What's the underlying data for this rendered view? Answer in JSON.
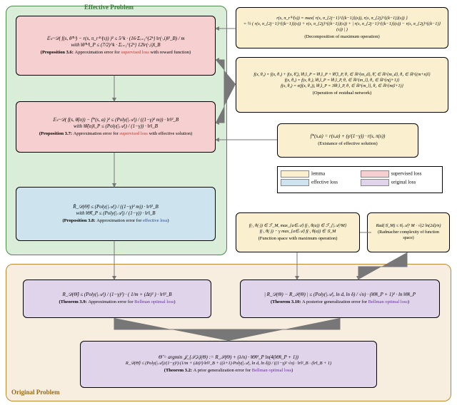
{
  "groups": {
    "effective_title": "Effective Problem",
    "original_title": "Original Problem"
  },
  "boxes": {
    "p36": {
      "math1": "𝔼ₛ~𝒟( f(s, θ̂⁽ᵏ⁾) − r(s, π_r⁽ᵏ⁾(s)) )² ≤ 5^k · (16·Σᵢ₌₁^{2ᵏ} ‖r(·,i)‖²_B) / m",
      "math2": "with  ‖θ̂⁽ᵏ⁾‖_P ≤ (7/2)^k · Σᵢ₌₁^{2ᵏ} 12‖r(·,i)‖_B",
      "caption_strong": "(Proposition 3.6: ",
      "caption_mid": "Approximation error for ",
      "caption_hl": "supervised loss",
      "caption_end": " with reward function)"
    },
    "p37": {
      "math1": "𝔼ₛ~𝒟( f(s, θ̂(α)) − f*(s, a) )² ≤ (Poly(|𝒜|) / ((1−γ)² m)) · ‖r‖²_B",
      "math2": "with  ‖θ̂(α)‖_P ≤ (Poly(|𝒜|) / (1−γ)) · ‖r‖_B",
      "caption_strong": "(Proposition 3.7: ",
      "caption_mid": "Approximation error for ",
      "caption_hl": "supervised loss",
      "caption_end": " with effective solution)"
    },
    "p38": {
      "math1": "R̂_𝒟(Θ̂) ≤ (Poly(|𝒜|) / ((1−γ)² m)) · ‖r‖²_B",
      "math2": "with  ‖Θ̂‖_P ≤ (Poly(|𝒜|) / (1−γ)) · ‖r‖_B",
      "caption_strong": "(Proposition 3.8: ",
      "caption_mid": "Approximation error for ",
      "caption_hl": "effective loss",
      "caption_end": ")"
    },
    "t39": {
      "math1": "R_𝒟(Θ̂) ≤ (Poly(|𝒜|) / (1−γ)²) · ( 1/m + (Δt)² ) · ‖r‖²_B",
      "caption_strong": "(Theorem 3.9: ",
      "caption_mid": "Approximation error for ",
      "caption_hl": "Bellman optimal loss",
      "caption_end": ")"
    },
    "t310": {
      "math1": "| R_𝒟(Θ) − R_𝒮(Θ) | ≤ (Poly(|𝒜|, ln d, ln δ) / √n) · (‖Θ‖_P + 1)² · ln ‖Θ‖_P",
      "caption_strong": "(Theorem 3.10: ",
      "caption_mid": "A posterior generalization error for ",
      "caption_hl": "Bellman optimal loss",
      "caption_end": ")"
    },
    "t32": {
      "math1": "Θ̂ = argmin 𝒥_{𝒮,λ}(Θ) := R_𝒮(Θ) + (λ/n) · ‖Θ‖²_P ln(4(‖Θ‖_P + 1))",
      "math2": "R_𝒟(Θ̂) ≤ (Poly(|𝒜|)/(1−γ)²)·(1/m + (Δt)²)·‖r‖²_B + ((λ+1)·Poly(|𝒜|, ln d, ln δ)) / ((1−γ)² √n) · ‖r‖²_B · (‖r‖_B + 1)",
      "caption_strong": "(Theorem 3.2: ",
      "caption_mid": "A prior generalization error for ",
      "caption_hl": "Bellman optimal loss",
      "caption_end": ")"
    },
    "lem_decomp": {
      "math1": "r(s, π_r⁽ᵏ⁾(s)) = max{ r(s, π_{2j−1}^{(k−1)}(s)), r(s, π_{2j}^{(k−1)}(s)) }",
      "math2": "= ½ ( r(s, π_{2j−1}^{(k−1)}(s)) + r(s, π_{2j}^{(k−1)}(s)) + | r(s, π_{2j−1}^{(k−1)}(s)) − r(s, π_{2j}^{(k−1)}(s)) | )",
      "caption": "(Decomposition of maximum operation)"
    },
    "lem_residual": {
      "math1": "f(x, θ₂) = f(x, θ₁) + f(x, θ̃₂),  ‖θ₂‖_P = ‖θ₁‖_P + ‖θ̃₂‖_P,  θ₁ ∈ ℝ^{m_d}, θ̃₂ ∈ ℝ^{m_d}, θ₂ ∈ ℝ^{(m+n)l}",
      "math2": "f(x, θ₂) = f(x, θ₁),  ‖θ₂‖_P = ‖θ₁‖_P,  θ₁ ∈ ℝ^{m_l}, θ₂ ∈ ℝ^{n(j+1)}",
      "math3": "f(x, θ₂) = σ(f(x, θ₁)),  ‖θ₂‖_P = 3‖θ₁‖_P,  θ₁ ∈ ℝ^{m_l}, θ₂ ∈ ℝ^{m(l+1)}",
      "caption": "(Operation of residual network)"
    },
    "lem_exist": {
      "math1": "f*(s,a) = r(s,a) + (γ/(1−γ)) · r(s, π(s))",
      "caption": "(Existance of effective solution)"
    },
    "lem_func": {
      "math1": "f(·, θ(·)) ∈ ℱ_M,   max_{a∈𝒜} f(·, θ(a)) ∈ ℱ_{|𝒜|³M}",
      "math2": "f(·, θ(·)) − γ max_{a∈𝒜} f(·, θ(a)) ∈ 𝒢_M",
      "caption": "(Function space with maximum operation)"
    },
    "lem_rad": {
      "math1": "Rad(𝒢_M) ≤ 6|𝒜|³ M · √(2 ln(2d)/n)",
      "caption": "(Radmacher complexity of function space)"
    }
  },
  "legend": {
    "l1": "lemma",
    "l2": "supervised loss",
    "l3": "effective loss",
    "l4": "original loss"
  }
}
